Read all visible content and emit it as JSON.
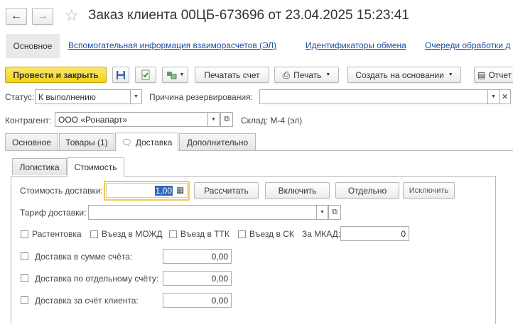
{
  "window": {
    "title": "Заказ клиента 00ЦБ-673696 от 23.04.2025 15:23:41"
  },
  "nav": {
    "main_label": "Основное",
    "links": [
      "Вспомогательная информация взаиморасчетов (ЭЛ)",
      "Идентификаторы обмена",
      "Очереди обработки д"
    ]
  },
  "toolbar": {
    "post_close": "Провести и закрыть",
    "print_invoice": "Печатать счет",
    "print": "Печать",
    "create_based": "Создать на основании",
    "reports": "Отчет"
  },
  "header": {
    "status_label": "Статус:",
    "status_value": "К выполнению",
    "reserve_reason_label": "Причина резервирования:",
    "reserve_reason_value": "",
    "counterparty_label": "Контрагент:",
    "counterparty_value": "ООО «Ронапарт»",
    "warehouse_text": "Склад: М-4 (эл)"
  },
  "tabs": [
    "Основное",
    "Товары (1)",
    "Доставка",
    "Дополнительно"
  ],
  "subtabs": [
    "Логистика",
    "Стоимость"
  ],
  "delivery": {
    "cost_label": "Стоимость доставки:",
    "cost_value": "1,00",
    "calc_button": "Рассчитать",
    "include_button": "Включить",
    "separate_button": "Отдельно",
    "exclude_button": "Исключить",
    "tariff_label": "Тариф доставки:",
    "tariff_value": "",
    "checkboxes": [
      "Растентовка",
      "Въезд в МОЖД",
      "Въезд в ТТК",
      "Въезд в СК"
    ],
    "mkad_label": "За МКАД:",
    "mkad_value": "0",
    "rows": [
      {
        "label": "Доставка в сумме счёта:",
        "value": "0,00"
      },
      {
        "label": "Доставка по отдельному счёту:",
        "value": "0,00"
      },
      {
        "label": "Доставка за счёт клиента:",
        "value": "0,00"
      }
    ]
  }
}
